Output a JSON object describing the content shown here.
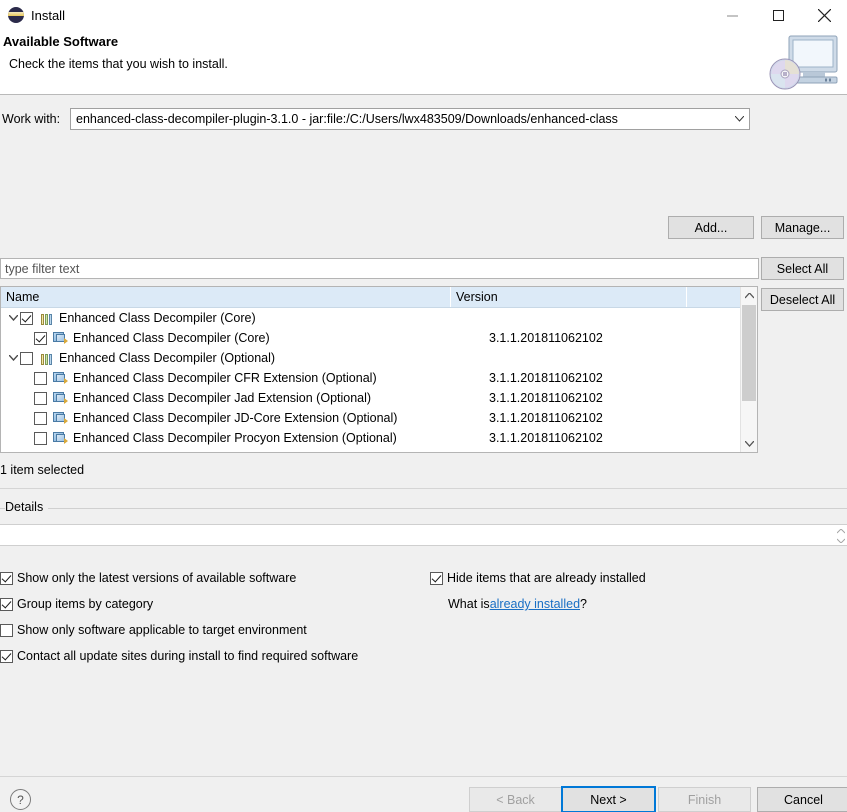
{
  "window": {
    "title": "Install",
    "icon": "eclipse-icon",
    "controls": {
      "minimize": "minimize-icon",
      "maximize": "maximize-icon",
      "close": "close-icon"
    }
  },
  "banner": {
    "title": "Available Software",
    "subtitle": "Check the items that you wish to install.",
    "art": "software-install-icon"
  },
  "workwith": {
    "label": "Work with:",
    "value": "enhanced-class-decompiler-plugin-3.1.0 - jar:file:/C:/Users/lwx483509/Downloads/enhanced-class",
    "add_label": "Add...",
    "manage_label": "Manage..."
  },
  "filter": {
    "placeholder": "type filter text",
    "value": ""
  },
  "tree": {
    "select_all_label": "Select All",
    "deselect_all_label": "Deselect All",
    "columns": [
      "Name",
      "Version",
      ""
    ],
    "rows": [
      {
        "level": 0,
        "expander": "expanded",
        "icon": "category-icon",
        "checked": true,
        "name": "Enhanced Class Decompiler (Core)",
        "version": ""
      },
      {
        "level": 1,
        "expander": "none",
        "icon": "feature-icon",
        "checked": true,
        "name": "Enhanced Class Decompiler (Core)",
        "version": "3.1.1.201811062102"
      },
      {
        "level": 0,
        "expander": "expanded",
        "icon": "category-icon",
        "checked": false,
        "name": "Enhanced Class Decompiler (Optional)",
        "version": ""
      },
      {
        "level": 1,
        "expander": "none",
        "icon": "feature-icon",
        "checked": false,
        "name": "Enhanced Class Decompiler CFR Extension (Optional)",
        "version": "3.1.1.201811062102"
      },
      {
        "level": 1,
        "expander": "none",
        "icon": "feature-icon",
        "checked": false,
        "name": "Enhanced Class Decompiler Jad Extension (Optional)",
        "version": "3.1.1.201811062102"
      },
      {
        "level": 1,
        "expander": "none",
        "icon": "feature-icon",
        "checked": false,
        "name": "Enhanced Class Decompiler JD-Core Extension (Optional)",
        "version": "3.1.1.201811062102"
      },
      {
        "level": 1,
        "expander": "none",
        "icon": "feature-icon",
        "checked": false,
        "name": "Enhanced Class Decompiler Procyon Extension (Optional)",
        "version": "3.1.1.201811062102"
      }
    ]
  },
  "status": {
    "text": "1 item selected"
  },
  "details": {
    "legend": "Details",
    "value": ""
  },
  "options": {
    "left": [
      {
        "label": "Show only the latest versions of available software",
        "checked": true
      },
      {
        "label": "Group items by category",
        "checked": true
      },
      {
        "label": "Show only software applicable to target environment",
        "checked": false
      },
      {
        "label": "Contact all update sites during install to find required software",
        "checked": true
      }
    ],
    "right": [
      {
        "label": "Hide items that are already installed",
        "checked": true
      }
    ],
    "whatis_prefix": "What is ",
    "whatis_link": "already installed",
    "whatis_suffix": "?"
  },
  "footer": {
    "help": "?",
    "back": "< Back",
    "next": "Next >",
    "finish": "Finish",
    "cancel": "Cancel"
  },
  "colors": {
    "accent": "#0078d7",
    "link": "#1a6fc4",
    "header_bg": "#dceaf7",
    "dialog_bg": "#f0f0f0"
  }
}
